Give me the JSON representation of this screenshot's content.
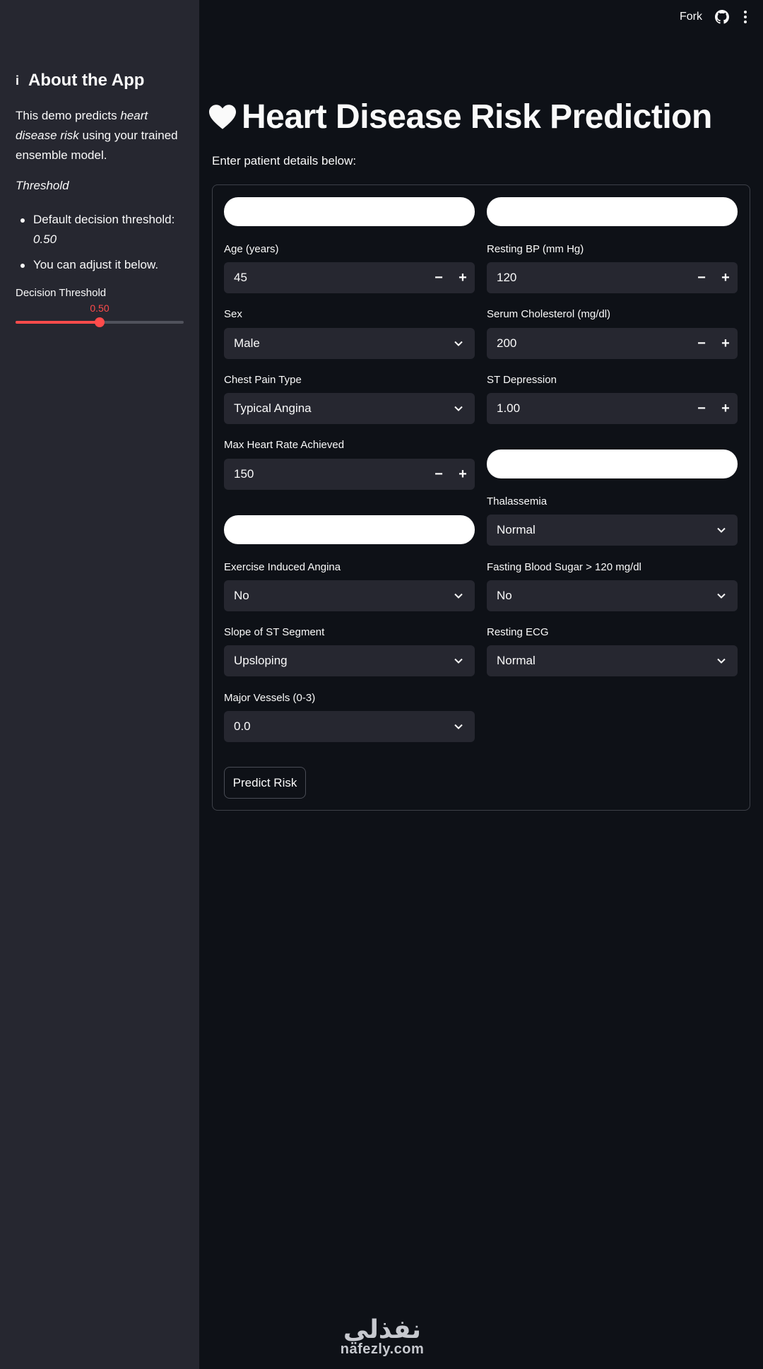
{
  "topbar": {
    "fork_label": "Fork",
    "icons": [
      "github-icon",
      "more-vertical-icon"
    ]
  },
  "sidebar": {
    "title": "About the App",
    "info_glyph": "i",
    "description_prefix": "This demo predicts ",
    "description_italic": "heart disease risk",
    "description_suffix": " using your trained ensemble model.",
    "threshold_heading": "Threshold",
    "bullets": [
      {
        "text": "Default decision threshold: ",
        "italic": "0.50"
      },
      {
        "text": "You can adjust it below."
      }
    ],
    "slider": {
      "label": "Decision Threshold",
      "value_text": "0.50",
      "value": 0.5,
      "min": 0,
      "max": 1,
      "accent": "#ff4b4b"
    }
  },
  "main": {
    "title": "Heart Disease Risk Prediction",
    "subtitle": "Enter patient details below:",
    "fields": {
      "age": {
        "label": "Age (years)",
        "value": "45"
      },
      "resting_bp": {
        "label": "Resting BP (mm Hg)",
        "value": "120"
      },
      "sex": {
        "label": "Sex",
        "value": "Male"
      },
      "cholesterol": {
        "label": "Serum Cholesterol (mg/dl)",
        "value": "200"
      },
      "chest_pain": {
        "label": "Chest Pain Type",
        "value": "Typical Angina"
      },
      "st_depression": {
        "label": "ST Depression",
        "value": "1.00"
      },
      "max_hr": {
        "label": "Max Heart Rate Achieved",
        "value": "150"
      },
      "thalassemia": {
        "label": "Thalassemia",
        "value": "Normal"
      },
      "exercise_angina": {
        "label": "Exercise Induced Angina",
        "value": "No"
      },
      "fasting_bs": {
        "label": "Fasting Blood Sugar > 120 mg/dl",
        "value": "No"
      },
      "slope": {
        "label": "Slope of ST Segment",
        "value": "Upsloping"
      },
      "resting_ecg": {
        "label": "Resting ECG",
        "value": "Normal"
      },
      "major_vessels": {
        "label": "Major Vessels (0-3)",
        "value": "0.0"
      }
    },
    "stepper": {
      "minus": "−",
      "plus": "+"
    },
    "predict_label": "Predict Risk"
  },
  "watermark": {
    "arabic": "نفذلي",
    "latin": "nafezly.com"
  },
  "colors": {
    "background": "#0e1117",
    "sidebar": "#262730",
    "input_bg": "#262730",
    "accent": "#ff4b4b",
    "text": "#fafafa"
  }
}
